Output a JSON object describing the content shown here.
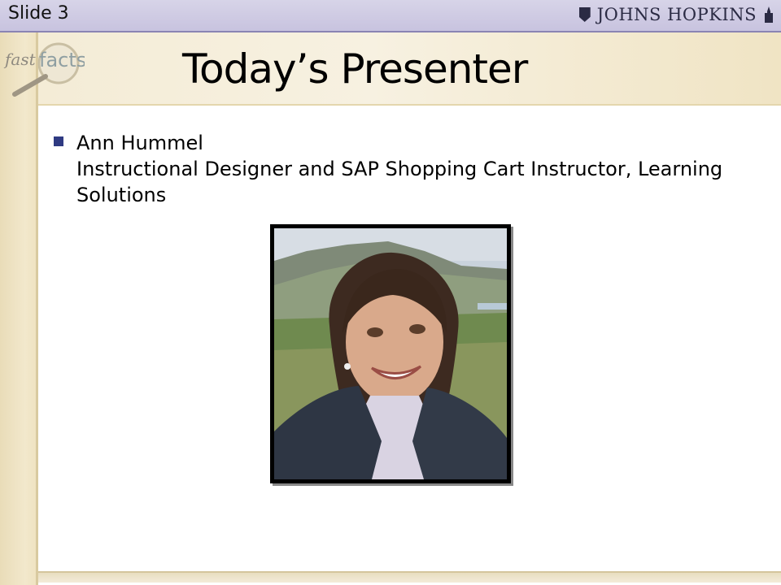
{
  "slide": {
    "label": "Slide 3",
    "title": "Today’s Presenter",
    "logo_text": "JOHNS HOPKINS",
    "corner_logo": "fast facts",
    "bullets": [
      {
        "name": "Ann Hummel",
        "role": "Instructional Designer and SAP Shopping Cart Instructor, Learning Solutions"
      }
    ],
    "photo_subject": "presenter-photo"
  },
  "colors": {
    "top_band": "#c8c3df",
    "bullet": "#2f3a82",
    "title_band": "#f4ecd6"
  }
}
